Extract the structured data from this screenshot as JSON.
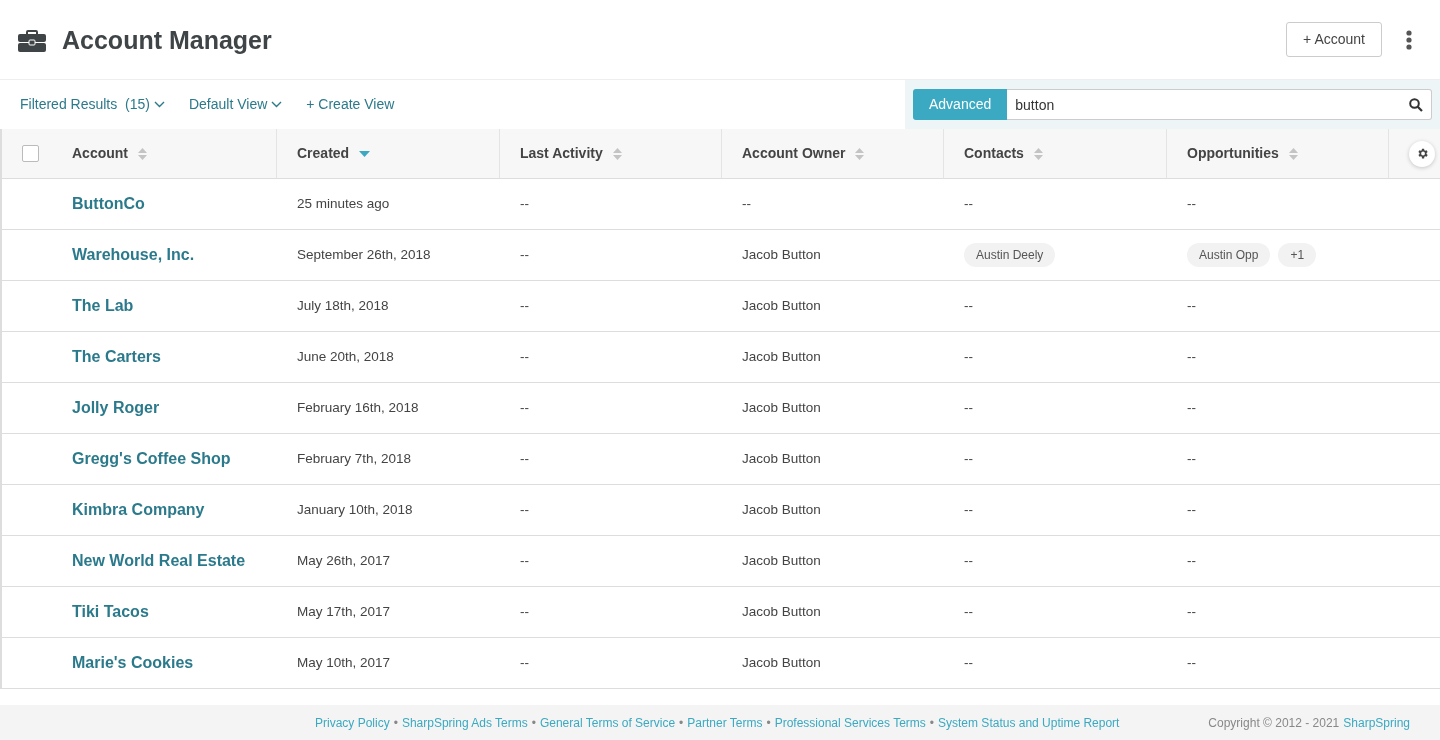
{
  "header": {
    "title": "Account Manager",
    "add_button": "+ Account"
  },
  "toolbar": {
    "filters": [
      {
        "label": "Filtered Results",
        "count": "(15)",
        "kind": "dropdown"
      },
      {
        "label": "Default View",
        "kind": "dropdown"
      },
      {
        "label": "+ Create View",
        "kind": "link"
      }
    ],
    "search": {
      "mode_button": "Advanced",
      "value": "button"
    }
  },
  "table": {
    "select_all": {
      "checked": false
    },
    "columns": [
      {
        "label": "Account",
        "sorted": false
      },
      {
        "label": "Created",
        "sorted": true
      },
      {
        "label": "Last Activity",
        "sorted": false
      },
      {
        "label": "Account Owner",
        "sorted": false
      },
      {
        "label": "Contacts",
        "sorted": false
      },
      {
        "label": "Opportunities",
        "sorted": false
      }
    ],
    "rows": [
      {
        "account": "ButtonCo",
        "created": "25 minutes ago",
        "last_activity": "--",
        "owner": "--",
        "contacts": "--",
        "opportunities": "--"
      },
      {
        "account": "Warehouse, Inc.",
        "created": "September 26th, 2018",
        "last_activity": "--",
        "owner": "Jacob Button",
        "contacts": [
          "Austin Deely"
        ],
        "opportunities": [
          "Austin Opp",
          "+1"
        ]
      },
      {
        "account": "The Lab",
        "created": "July 18th, 2018",
        "last_activity": "--",
        "owner": "Jacob Button",
        "contacts": "--",
        "opportunities": "--"
      },
      {
        "account": "The Carters",
        "created": "June 20th, 2018",
        "last_activity": "--",
        "owner": "Jacob Button",
        "contacts": "--",
        "opportunities": "--"
      },
      {
        "account": "Jolly Roger",
        "created": "February 16th, 2018",
        "last_activity": "--",
        "owner": "Jacob Button",
        "contacts": "--",
        "opportunities": "--"
      },
      {
        "account": "Gregg's Coffee Shop",
        "created": "February 7th, 2018",
        "last_activity": "--",
        "owner": "Jacob Button",
        "contacts": "--",
        "opportunities": "--"
      },
      {
        "account": "Kimbra Company",
        "created": "January 10th, 2018",
        "last_activity": "--",
        "owner": "Jacob Button",
        "contacts": "--",
        "opportunities": "--"
      },
      {
        "account": "New World Real Estate",
        "created": "May 26th, 2017",
        "last_activity": "--",
        "owner": "Jacob Button",
        "contacts": "--",
        "opportunities": "--"
      },
      {
        "account": "Tiki Tacos",
        "created": "May 17th, 2017",
        "last_activity": "--",
        "owner": "Jacob Button",
        "contacts": "--",
        "opportunities": "--"
      },
      {
        "account": "Marie's Cookies",
        "created": "May 10th, 2017",
        "last_activity": "--",
        "owner": "Jacob Button",
        "contacts": "--",
        "opportunities": "--"
      }
    ]
  },
  "footer": {
    "links": [
      "Privacy Policy",
      "SharpSpring Ads Terms",
      "General Terms of Service",
      "Partner Terms",
      "Professional Services Terms",
      "System Status and Uptime Report"
    ],
    "separator": "•",
    "copyright": "Copyright © 2012 - 2021",
    "brand_link": "SharpSpring"
  }
}
